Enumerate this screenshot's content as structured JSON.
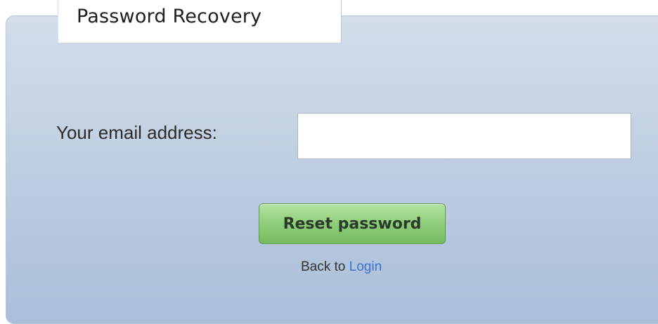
{
  "form": {
    "tab_title": "Password Recovery",
    "email_label": "Your email address:",
    "email_value": "",
    "email_placeholder": "",
    "reset_button_label": "Reset password",
    "back_prefix": "Back to ",
    "login_link_label": "Login"
  },
  "colors": {
    "panel_top": "#d3deea",
    "panel_bottom": "#aabfd9",
    "button_green": "#8fcd7a",
    "link_blue": "#3f72c9"
  }
}
